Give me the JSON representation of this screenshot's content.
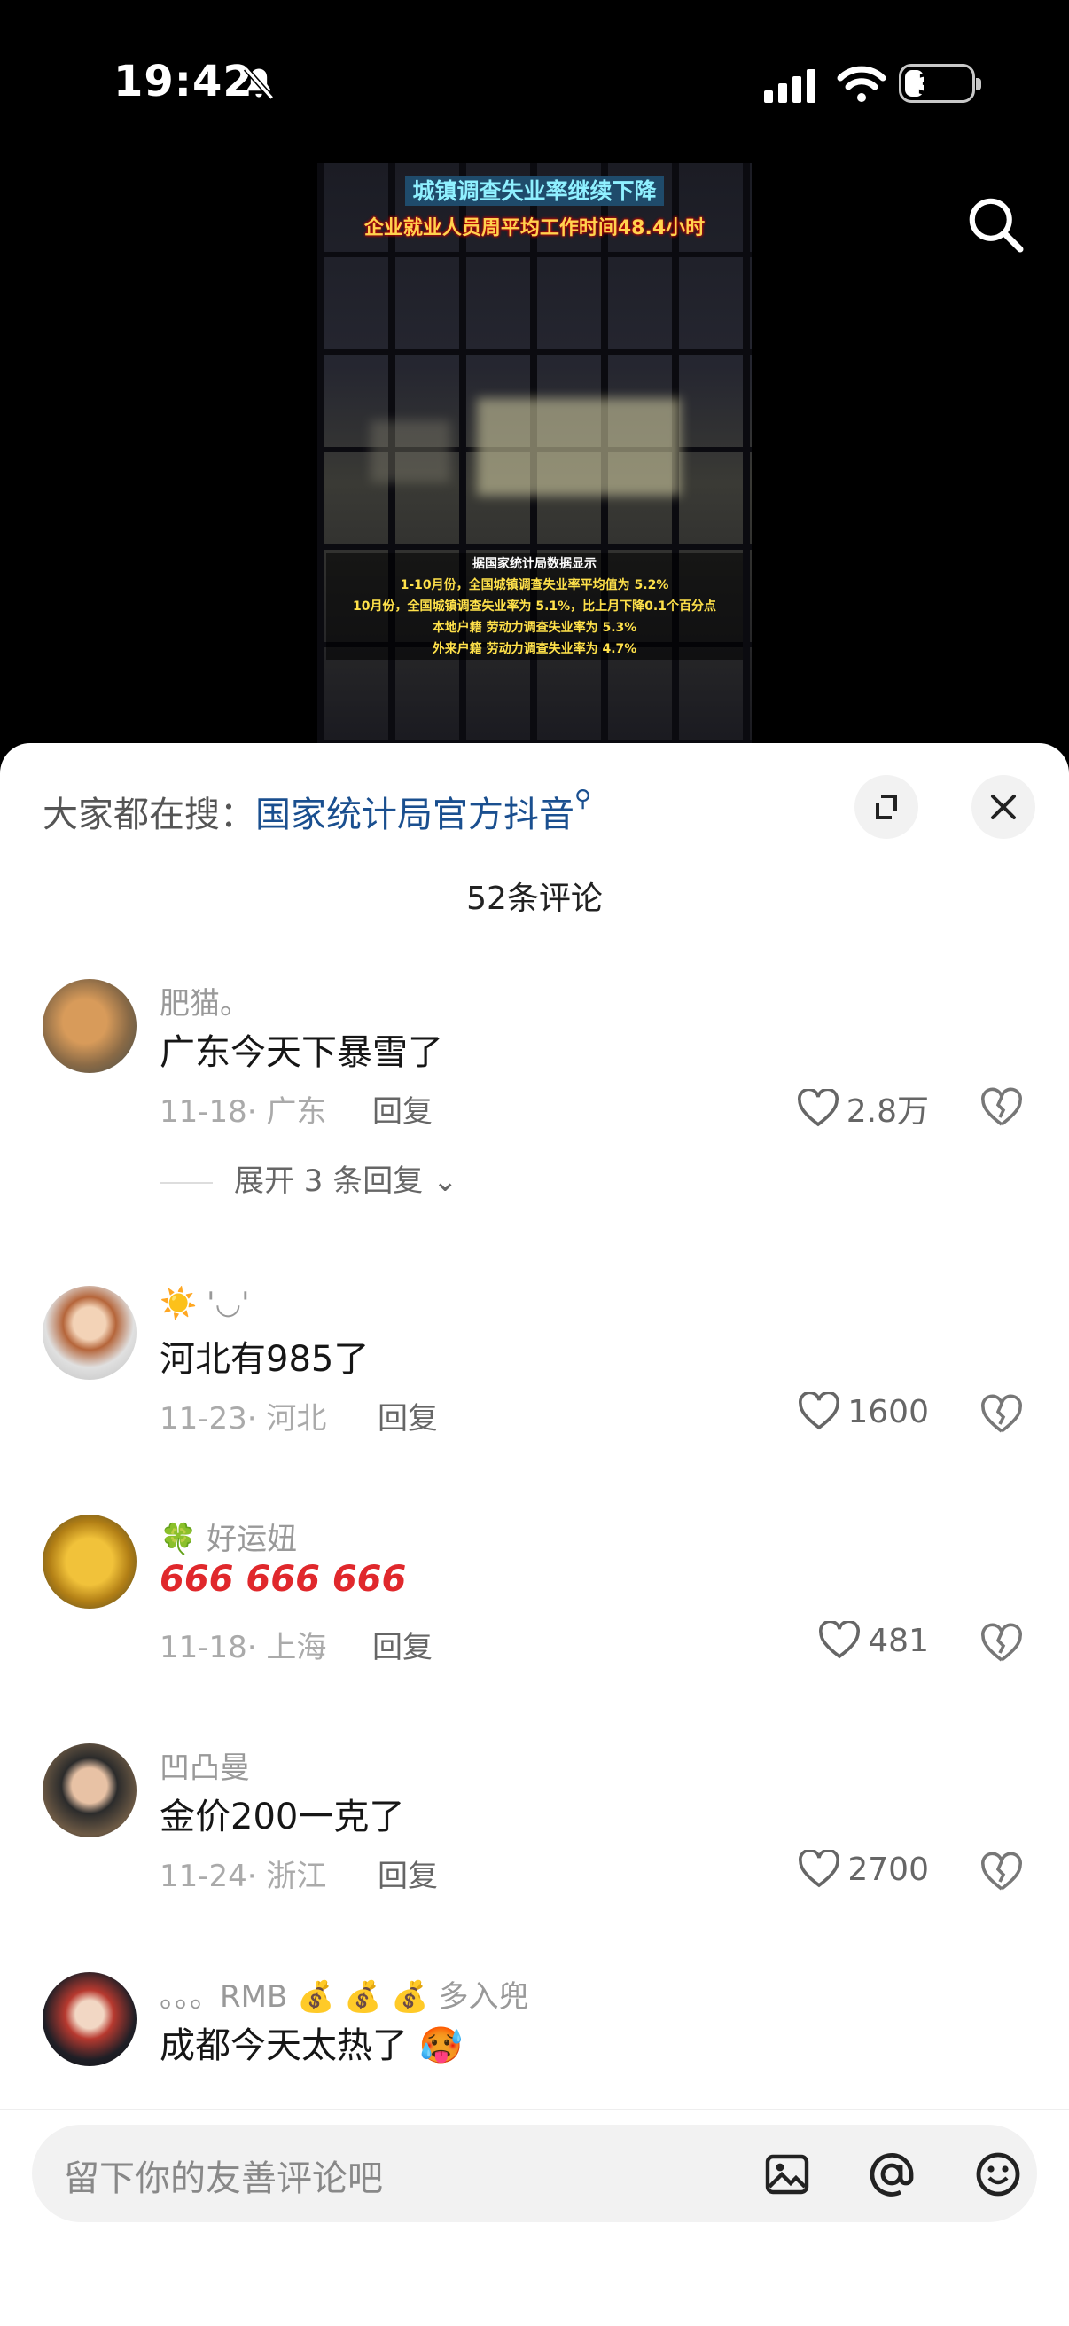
{
  "status": {
    "time": "19:42",
    "battery": "30"
  },
  "video": {
    "title1": "城镇调查失业率继续下降",
    "title2": "企业就业人员周平均工作时间48.4小时",
    "box_lines": [
      "据国家统计局数据显示",
      "1-10月份，全国城镇调查失业率平均值为 5.2%",
      "10月份，全国城镇调查失业率为 5.1%，比上月下降0.1个百分点",
      "本地户籍 劳动力调查失业率为 5.3%",
      "外来户籍 劳动力调查失业率为 4.7%"
    ]
  },
  "sheet": {
    "hot_prefix": "大家都在搜：",
    "hot_keyword": "国家统计局官方抖音",
    "comment_count": "52条评论"
  },
  "comments": [
    {
      "name": "肥猫。",
      "text": "广东今天下暴雪了",
      "meta": "11-18· 广东",
      "reply": "回复",
      "likes": "2.8万",
      "expand": "展开 3 条回复"
    },
    {
      "name": "☀️ '◡'",
      "text": "河北有985了",
      "meta": "11-23· 河北",
      "reply": "回复",
      "likes": "1600"
    },
    {
      "name": "🍀 好运妞",
      "text": "666 666 666",
      "meta": "11-18· 上海",
      "reply": "回复",
      "likes": "481"
    },
    {
      "name": "凹凸曼",
      "text": "金价200一克了",
      "meta": "11-24· 浙江",
      "reply": "回复",
      "likes": "2700"
    },
    {
      "name": "。。。RMB 💰 💰 💰 多入兜",
      "text": "成都今天太热了 🥵"
    }
  ],
  "input": {
    "placeholder": "留下你的友善评论吧"
  }
}
